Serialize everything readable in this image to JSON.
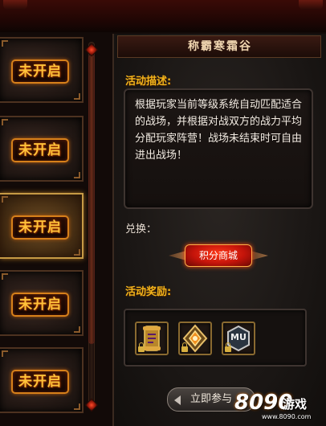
{
  "list": {
    "items": [
      {
        "status": "未开启",
        "active": false
      },
      {
        "status": "未开启",
        "active": false
      },
      {
        "status": "未开启",
        "active": true
      },
      {
        "status": "未开启",
        "active": false
      },
      {
        "status": "未开启",
        "active": false
      }
    ]
  },
  "detail": {
    "title": "称霸寒霜谷",
    "description_label": "活动描述:",
    "description": "根据玩家当前等级系统自动匹配适合的战场，并根据对战双方的战力平均分配玩家阵营！战场未结束时可自由进出战场！",
    "exchange_label": "兑换：",
    "shop_button": "积分商城",
    "reward_label": "活动奖励:",
    "rewards": [
      {
        "icon": "scroll-icon",
        "locked": true
      },
      {
        "icon": "rank-emblem-icon",
        "locked": true
      },
      {
        "icon": "mu-badge-icon",
        "text": "MU",
        "locked": true
      }
    ],
    "join_button": "立即参与"
  },
  "watermark": {
    "number": "8090",
    "brand": "游戏",
    "url": "www.8090.com"
  },
  "colors": {
    "accent_gold": "#f3b41c",
    "badge_orange": "#d6801a",
    "shop_red": "#c4140a"
  }
}
